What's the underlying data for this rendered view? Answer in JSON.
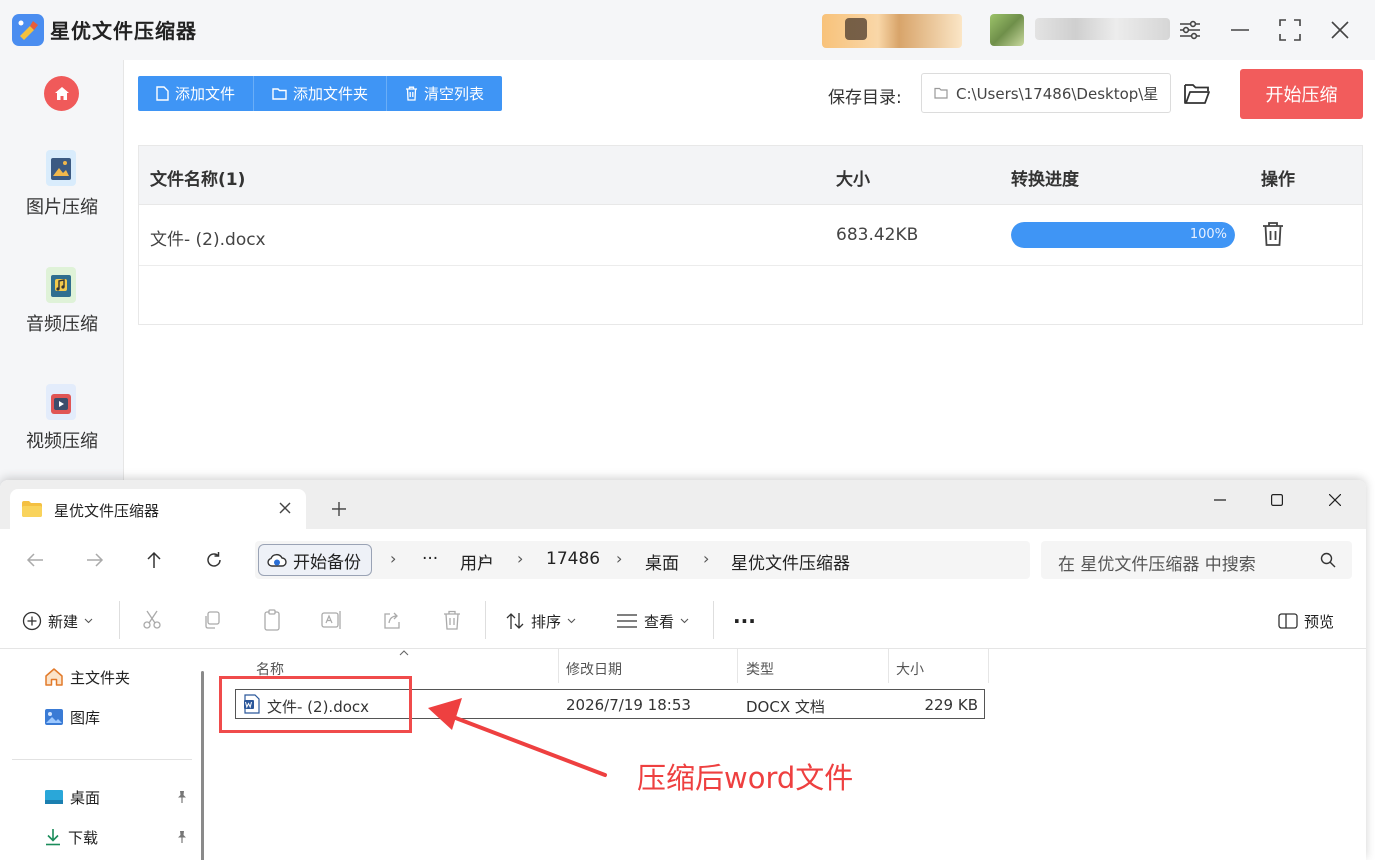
{
  "app": {
    "title": "星优文件压缩器",
    "sidebar": [
      {
        "label": "图片压缩",
        "icon": "image-icon"
      },
      {
        "label": "音频压缩",
        "icon": "music-icon"
      },
      {
        "label": "视频压缩",
        "icon": "video-icon"
      }
    ],
    "toolbar": {
      "add_file": "添加文件",
      "add_folder": "添加文件夹",
      "clear_list": "清空列表"
    },
    "save_dir": {
      "label": "保存目录:",
      "value": "C:\\Users\\17486\\Desktop\\星"
    },
    "start_button": "开始压缩",
    "table": {
      "headers": {
        "name": "文件名称(1)",
        "size": "大小",
        "progress": "转换进度",
        "action": "操作"
      },
      "rows": [
        {
          "name": "文件- (2).docx",
          "size": "683.42KB",
          "progress_label": "100%",
          "progress": 1.0
        }
      ]
    }
  },
  "explorer": {
    "tab_title": "星优文件压缩器",
    "address": {
      "backup": "开始备份",
      "ellipsis": "···",
      "crumbs": [
        "用户",
        "17486",
        "桌面",
        "星优文件压缩器"
      ]
    },
    "search_placeholder": "在 星优文件压缩器 中搜索",
    "commands": {
      "new": "新建",
      "sort": "排序",
      "view": "查看",
      "more": "···",
      "preview": "预览"
    },
    "nav": {
      "home": "主文件夹",
      "gallery": "图库",
      "desktop": "桌面",
      "downloads": "下载"
    },
    "columns": {
      "name": "名称",
      "modified": "修改日期",
      "type": "类型",
      "size": "大小"
    },
    "file": {
      "name": "文件- (2).docx",
      "modified": "2026/7/19 18:53",
      "type": "DOCX 文档",
      "size": "229 KB"
    }
  },
  "annotation": {
    "text": "压缩后word文件",
    "color": "#ee4040"
  },
  "colors": {
    "accent_blue": "#3f95f5",
    "accent_red": "#f25c5c"
  }
}
